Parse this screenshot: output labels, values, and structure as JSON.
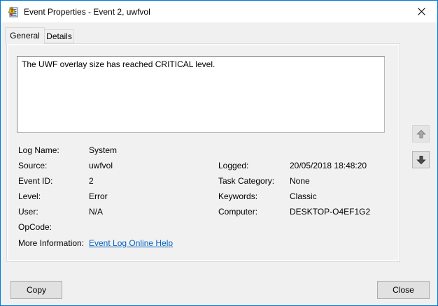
{
  "window": {
    "title": "Event Properties - Event 2, uwfvol"
  },
  "icons": {
    "title_icon": "event-properties-icon",
    "close": "close-icon",
    "up": "arrow-up-icon",
    "down": "arrow-down-icon"
  },
  "colors": {
    "accent_border": "#0078d7",
    "titlebar_bg": "#ffffff",
    "body_bg": "#f0f0f0",
    "link": "#0563c1",
    "button_bg": "#e1e1e1",
    "button_border": "#adadad"
  },
  "tabs": [
    {
      "label": "General",
      "active": true
    },
    {
      "label": "Details",
      "active": false
    }
  ],
  "general": {
    "message": "The UWF overlay size has reached CRITICAL level.",
    "rows": [
      {
        "l_label": "Log Name:",
        "l_value": "System",
        "r_label": "",
        "r_value": ""
      },
      {
        "l_label": "Source:",
        "l_value": "uwfvol",
        "r_label": "Logged:",
        "r_value": "20/05/2018 18:48:20"
      },
      {
        "l_label": "Event ID:",
        "l_value": "2",
        "r_label": "Task Category:",
        "r_value": "None"
      },
      {
        "l_label": "Level:",
        "l_value": "Error",
        "r_label": "Keywords:",
        "r_value": "Classic"
      },
      {
        "l_label": "User:",
        "l_value": "N/A",
        "r_label": "Computer:",
        "r_value": "DESKTOP-O4EF1G2"
      },
      {
        "l_label": "OpCode:",
        "l_value": "",
        "r_label": "",
        "r_value": ""
      }
    ],
    "more_info": {
      "label": "More Information:",
      "link_text": "Event Log Online Help"
    }
  },
  "buttons": {
    "copy": "Copy",
    "close": "Close"
  }
}
